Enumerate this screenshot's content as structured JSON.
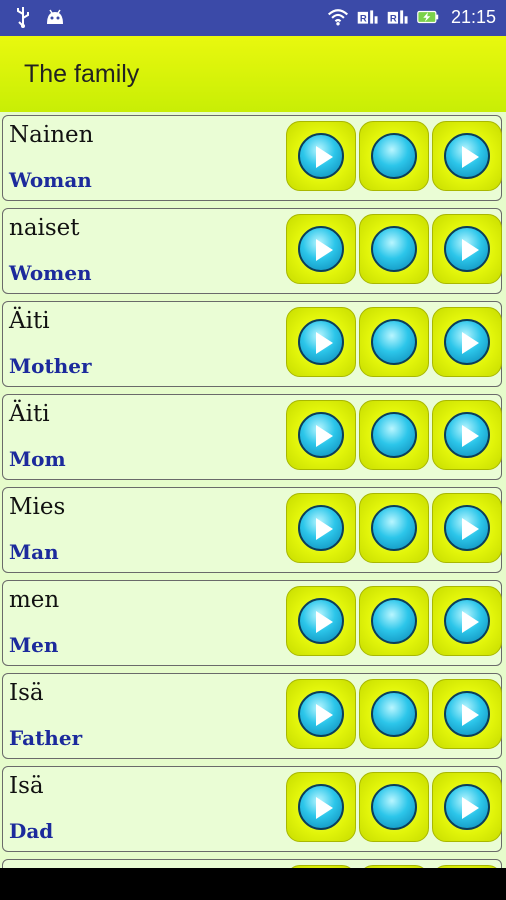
{
  "status": {
    "time": "21:15",
    "icons": [
      "usb-icon",
      "android-icon",
      "wifi-icon",
      "roaming-signal-icon",
      "roaming-signal-2-icon",
      "battery-charging-icon"
    ],
    "badge1": "R",
    "badge2": "R"
  },
  "header": {
    "title": "The family"
  },
  "colors": {
    "accent": "#e2f50a",
    "list_bg": "#e6fccb",
    "status_bg": "#3b4aa8",
    "translation": "#1c2a9c"
  },
  "rows": [
    {
      "word": "Nainen",
      "translation": "Woman"
    },
    {
      "word": "naiset",
      "translation": "Women"
    },
    {
      "word": "Äiti",
      "translation": "Mother"
    },
    {
      "word": "Äiti",
      "translation": "Mom"
    },
    {
      "word": "Mies",
      "translation": "Man"
    },
    {
      "word": "men",
      "translation": "Men"
    },
    {
      "word": "Isä",
      "translation": "Father"
    },
    {
      "word": "Isä",
      "translation": "Dad"
    },
    {
      "word": "",
      "translation": ""
    }
  ]
}
